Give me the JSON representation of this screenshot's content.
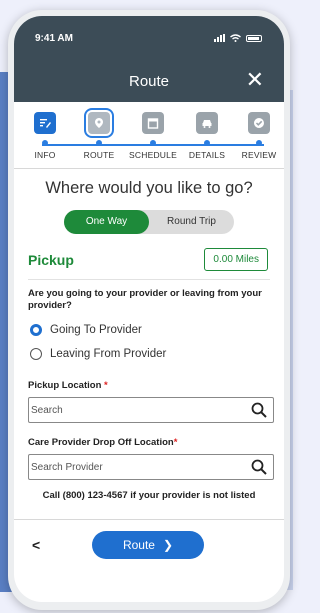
{
  "status": {
    "time": "9:41 AM"
  },
  "header": {
    "title": "Route",
    "close_glyph": "✕"
  },
  "steps": [
    {
      "label": "INFO",
      "icon": "edit-icon"
    },
    {
      "label": "ROUTE",
      "icon": "map-pin-icon"
    },
    {
      "label": "SCHEDULE",
      "icon": "calendar-icon"
    },
    {
      "label": "DETAILS",
      "icon": "car-icon"
    },
    {
      "label": "REVIEW",
      "icon": "check-icon"
    }
  ],
  "question": "Where would you like to go?",
  "trip_toggle": {
    "one_way": "One Way",
    "round_trip": "Round Trip",
    "selected": "One Way"
  },
  "pickup": {
    "title": "Pickup",
    "miles": "0.00 Miles"
  },
  "going_question": "Are you going to your provider or leaving from your provider?",
  "radios": {
    "going": "Going To Provider",
    "leaving": "Leaving From Provider",
    "selected": "Going To Provider"
  },
  "pickup_location": {
    "label": "Pickup Location",
    "required": "*",
    "placeholder": "Search"
  },
  "dropoff": {
    "label": "Care Provider Drop Off Location",
    "required": "*",
    "placeholder": "Search Provider"
  },
  "call_note": "Call (800) 123-4567 if your provider is not listed",
  "footer": {
    "back_glyph": "<",
    "route_label": "Route",
    "route_glyph": "❯"
  },
  "colors": {
    "header": "#3c4c57",
    "accent": "#1f6fcf",
    "green": "#1e8a3a"
  }
}
